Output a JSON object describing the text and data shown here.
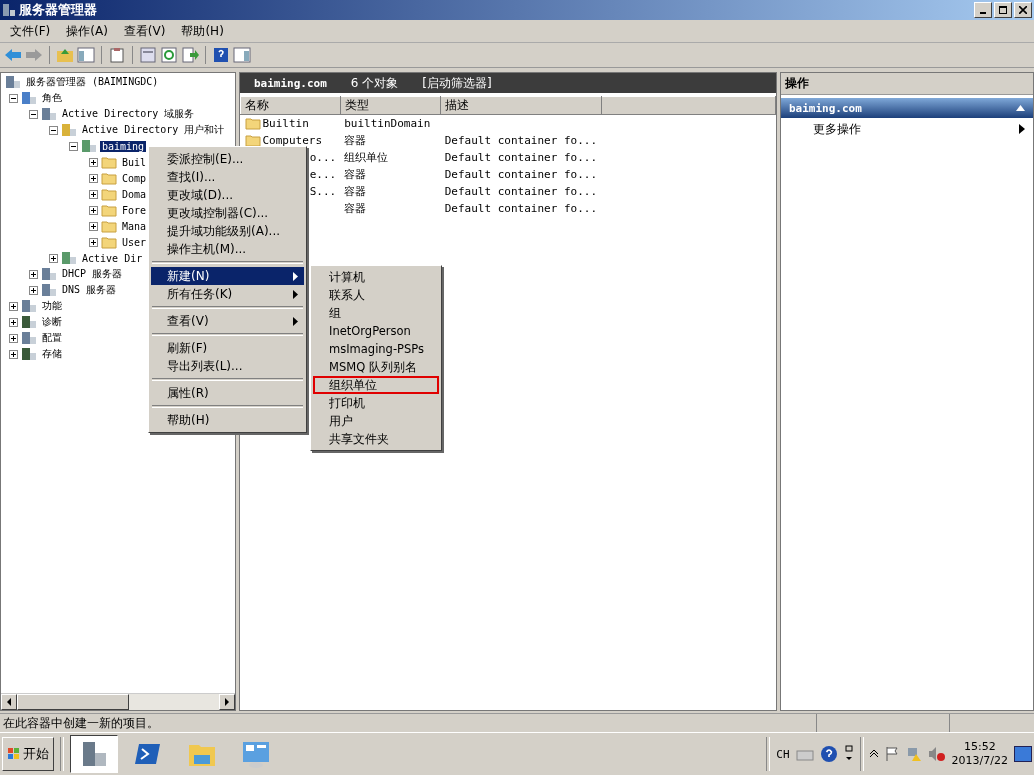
{
  "window": {
    "title": "服务器管理器"
  },
  "menu_bar": [
    "文件(F)",
    "操作(A)",
    "查看(V)",
    "帮助(H)"
  ],
  "tree": [
    {
      "label": "服务器管理器 (BAIMINGDC)",
      "kind": "server",
      "selected": false,
      "children": [
        {
          "label": "角色",
          "kind": "roles",
          "expanded": true,
          "selected": false,
          "children": [
            {
              "label": "Active Directory 域服务",
              "kind": "server",
              "expanded": true,
              "selected": false,
              "children": [
                {
                  "label": "Active Directory 用户和计",
                  "kind": "book",
                  "expanded": true,
                  "selected": false,
                  "children": [
                    {
                      "label": "baiming",
                      "kind": "domain",
                      "expanded": true,
                      "selected": true,
                      "children": [
                        {
                          "label": "Buil",
                          "kind": "folder",
                          "expanded": false,
                          "selected": false
                        },
                        {
                          "label": "Comp",
                          "kind": "folder",
                          "expanded": false,
                          "selected": false
                        },
                        {
                          "label": "Doma",
                          "kind": "folder",
                          "expanded": false,
                          "selected": false
                        },
                        {
                          "label": "Fore",
                          "kind": "folder",
                          "expanded": false,
                          "selected": false
                        },
                        {
                          "label": "Mana",
                          "kind": "folder",
                          "expanded": false,
                          "selected": false
                        },
                        {
                          "label": "User",
                          "kind": "folder",
                          "expanded": false,
                          "selected": false
                        }
                      ]
                    }
                  ]
                },
                {
                  "label": "Active Dir",
                  "kind": "domain",
                  "expanded": false,
                  "selected": false
                }
              ]
            },
            {
              "label": "DHCP 服务器",
              "kind": "server",
              "expanded": false,
              "selected": false
            },
            {
              "label": "DNS 服务器",
              "kind": "server",
              "expanded": false,
              "selected": false
            }
          ]
        },
        {
          "label": "功能",
          "kind": "server",
          "expanded": false,
          "selected": false
        },
        {
          "label": "诊断",
          "kind": "monitor",
          "expanded": false,
          "selected": false
        },
        {
          "label": "配置",
          "kind": "server",
          "expanded": false,
          "selected": false
        },
        {
          "label": "存储",
          "kind": "monitor",
          "expanded": false,
          "selected": false
        }
      ]
    }
  ],
  "list_header": {
    "name": "baiming.com",
    "count": "6 个对象",
    "filter": "[启动筛选器]"
  },
  "table": {
    "columns": [
      "名称",
      "类型",
      "描述"
    ],
    "rows": [
      {
        "name": "Builtin",
        "partial": false,
        "type": "builtinDomain"
      },
      {
        "name": "Computers",
        "partial": false,
        "type": "容器",
        "description": "Default container fo..."
      },
      {
        "name": "o...",
        "partial": true,
        "type": "组织单位",
        "description": "Default container fo..."
      },
      {
        "name": "e...",
        "partial": true,
        "type": "容器",
        "description": "Default container fo..."
      },
      {
        "name": "S...",
        "partial": true,
        "type": "容器",
        "description": "Default container fo..."
      },
      {
        "type": "容器",
        "description": "Default container fo..."
      }
    ]
  },
  "actions": {
    "title": "操作",
    "section": "baiming.com",
    "items": [
      {
        "label": "更多操作"
      }
    ]
  },
  "context_menu": {
    "groups": [
      [
        {
          "label": "委派控制(E)...",
          "submenu": false,
          "selected": false
        },
        {
          "label": "查找(I)...",
          "submenu": false,
          "selected": false
        },
        {
          "label": "更改域(D)...",
          "submenu": false,
          "selected": false
        },
        {
          "label": "更改域控制器(C)...",
          "submenu": false,
          "selected": false
        },
        {
          "label": "提升域功能级别(A)...",
          "submenu": false,
          "selected": false
        },
        {
          "label": "操作主机(M)...",
          "submenu": false,
          "selected": false
        }
      ],
      [
        {
          "label": "新建(N)",
          "submenu": true,
          "selected": true
        },
        {
          "label": "所有任务(K)",
          "submenu": true,
          "selected": false
        }
      ],
      [
        {
          "label": "查看(V)",
          "submenu": true,
          "selected": false
        }
      ],
      [
        {
          "label": "刷新(F)",
          "submenu": false,
          "selected": false
        },
        {
          "label": "导出列表(L)...",
          "submenu": false,
          "selected": false
        }
      ],
      [
        {
          "label": "属性(R)",
          "submenu": false,
          "selected": false
        }
      ],
      [
        {
          "label": "帮助(H)",
          "submenu": false,
          "selected": false
        }
      ]
    ]
  },
  "submenu": [
    {
      "label": "计算机",
      "boxed": false
    },
    {
      "label": "联系人",
      "boxed": false
    },
    {
      "label": "组",
      "boxed": false
    },
    {
      "label": "InetOrgPerson",
      "boxed": false
    },
    {
      "label": "msImaging-PSPs",
      "boxed": false
    },
    {
      "label": "MSMQ 队列别名",
      "boxed": false
    },
    {
      "label": "组织单位",
      "boxed": true
    },
    {
      "label": "打印机",
      "boxed": false
    },
    {
      "label": "用户",
      "boxed": false
    },
    {
      "label": "共享文件夹",
      "boxed": false
    }
  ],
  "status_bar": "在此容器中创建一新的项目。",
  "taskbar": {
    "start": "开始",
    "apps": [
      {
        "kind": "server",
        "selected": true
      },
      {
        "kind": "shell",
        "selected": false
      },
      {
        "kind": "folder",
        "selected": false
      },
      {
        "kind": "panel",
        "selected": false
      }
    ],
    "language": "CH",
    "time": "15:52",
    "date": "2013/7/22"
  }
}
